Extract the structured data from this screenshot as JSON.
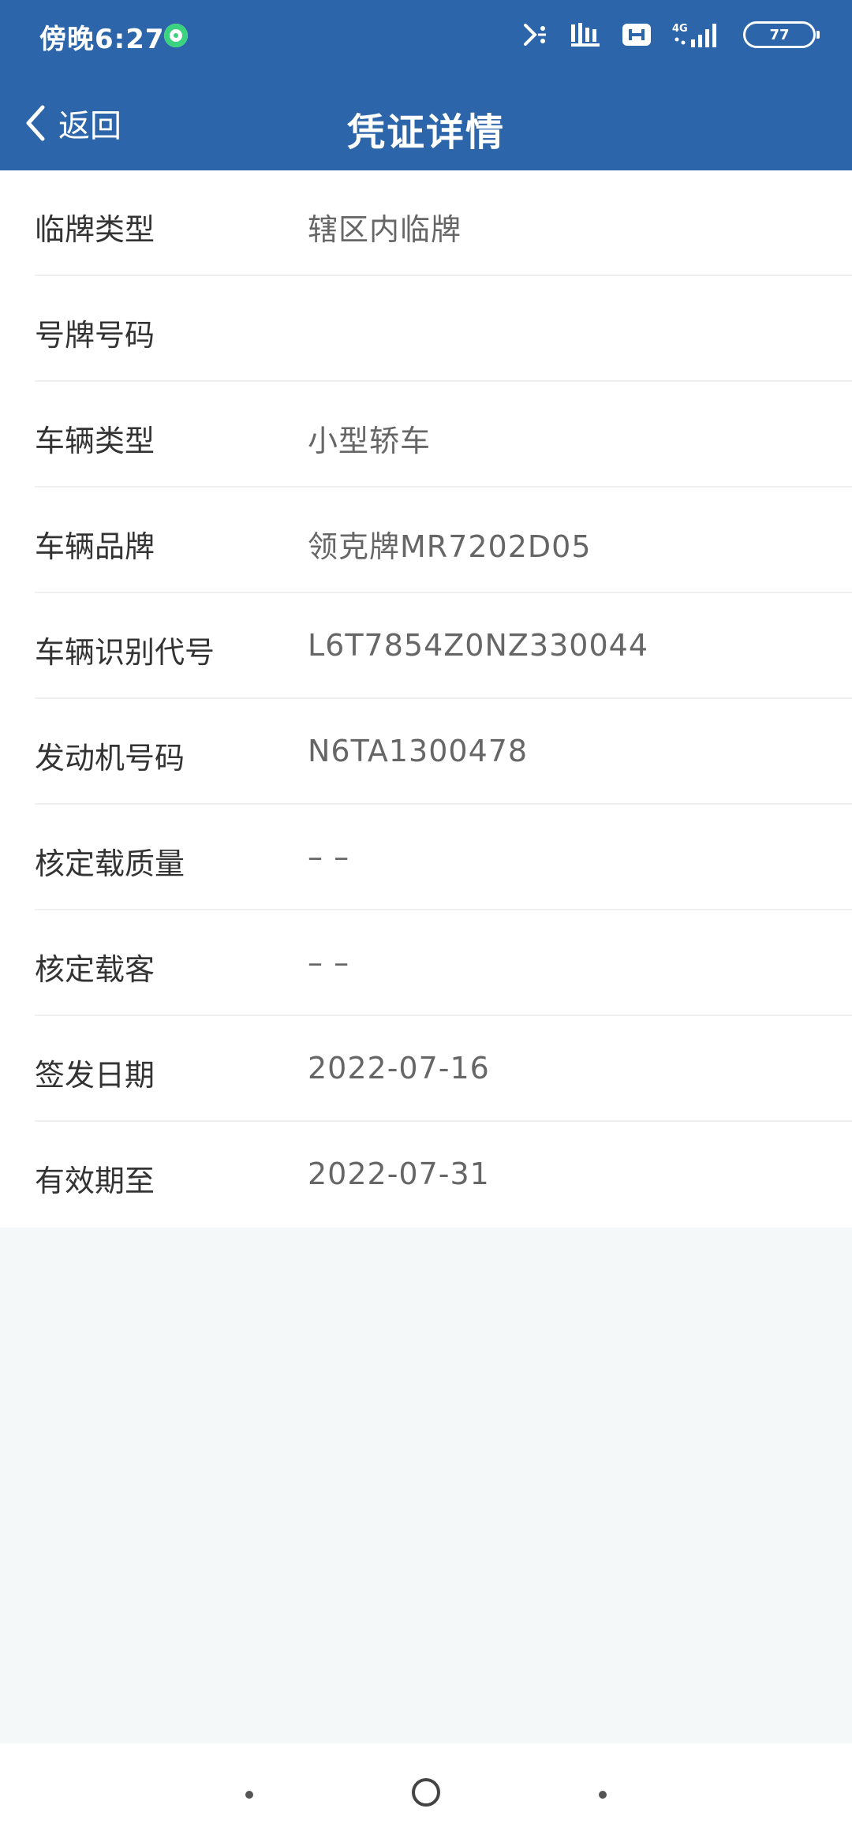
{
  "status_bar": {
    "time": "傍晚6:27",
    "network_label": "4G",
    "battery": "77",
    "icons": [
      "green-dot-icon",
      "signal-slash-icon",
      "voice-icon",
      "app-icon",
      "cellular-signal-icon",
      "battery-icon"
    ]
  },
  "header": {
    "back_label": "返回",
    "title": "凭证详情",
    "bg_color": "#2c65a9"
  },
  "details": [
    {
      "label": "临牌类型",
      "value": "辖区内临牌"
    },
    {
      "label": "号牌号码",
      "value": ""
    },
    {
      "label": "车辆类型",
      "value": "小型轿车"
    },
    {
      "label": "车辆品牌",
      "value": "领克牌MR7202D05"
    },
    {
      "label": "车辆识别代号",
      "value": "L6T7854Z0NZ330044"
    },
    {
      "label": "发动机号码",
      "value": "N6TA1300478"
    },
    {
      "label": "核定载质量",
      "value": "– –"
    },
    {
      "label": "核定载客",
      "value": "– –"
    },
    {
      "label": "签发日期",
      "value": "2022-07-16"
    },
    {
      "label": "有效期至",
      "value": "2022-07-31"
    }
  ]
}
